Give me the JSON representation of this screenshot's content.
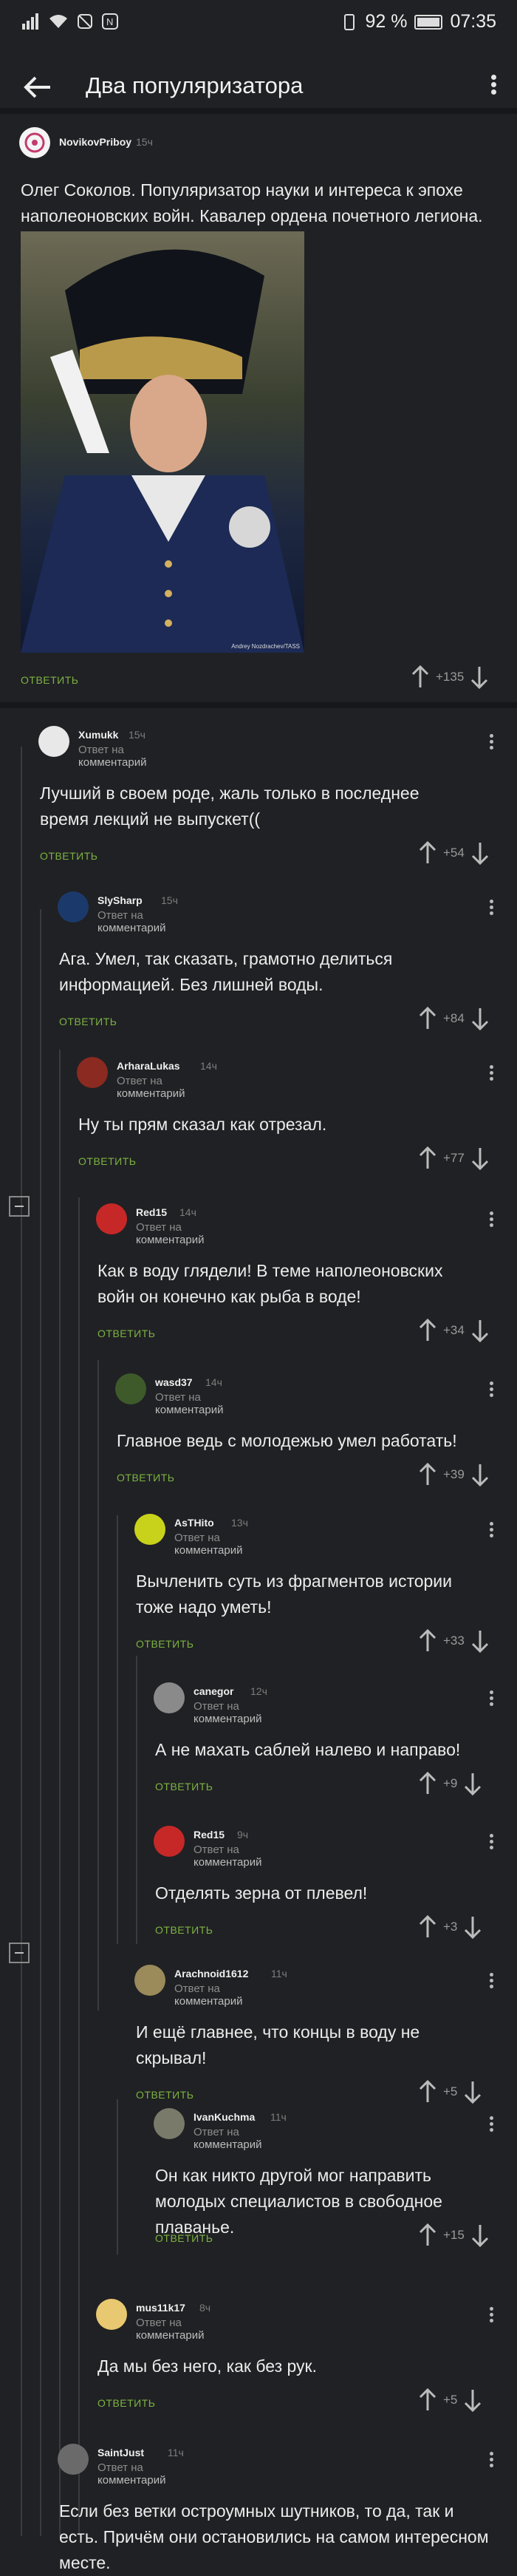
{
  "status_bar": {
    "battery": "92 %",
    "time": "07:35"
  },
  "app_bar": {
    "title": "Два популяризатора"
  },
  "reply_prefix": "Ответ на",
  "reply_word": "комментарий",
  "reply_label": "ОТВЕТИТЬ",
  "post": {
    "author": "NovikovPriboy",
    "time": "15ч",
    "text": "Олег Соколов. Популяризатор науки и интереса к эпохе наполеоновских войн. Кавалер ордена почетного легиона.",
    "photo_caption": "Andrey Nozdrachev/TASS",
    "score": "+135"
  },
  "comments": [
    {
      "author": "Xumukk",
      "time": "15ч",
      "text": "Лучший в своем роде, жаль только в последнее время лекций не выпускет((",
      "score": "+54"
    },
    {
      "author": "SlySharp",
      "time": "15ч",
      "text": "Ага. Умел, так сказать, грамотно делиться информацией. Без лишней воды.",
      "score": "+84"
    },
    {
      "author": "ArharaLukas",
      "time": "14ч",
      "text": "Ну ты прям сказал как отрезал.",
      "score": "+77"
    },
    {
      "author": "Red15",
      "time": "14ч",
      "text": "Как в воду глядели! В теме наполеоновских войн он конечно как рыба в воде!",
      "score": "+34"
    },
    {
      "author": "wasd37",
      "time": "14ч",
      "text": "Главное ведь с молодежью умел работать!",
      "score": "+39"
    },
    {
      "author": "AsTHito",
      "time": "13ч",
      "text": "Вычленить суть из фрагментов истории тоже надо уметь!",
      "score": "+33"
    },
    {
      "author": "canegor",
      "time": "12ч",
      "text": "А не махать саблей налево и направо!",
      "score": "+9"
    },
    {
      "author": "Red15",
      "time": "9ч",
      "text": "Отделять зерна от плевел!",
      "score": "+3"
    },
    {
      "author": "Arachnoid1612",
      "time": "11ч",
      "text": "И ещё главнее, что концы в воду не скрывал!",
      "score": "+5"
    },
    {
      "author": "IvanKuchma",
      "time": "11ч",
      "text": "Он как никто другой мог направить молодых специалистов в свободное плаванье.",
      "score": "+15"
    },
    {
      "author": "mus11k17",
      "time": "8ч",
      "text": "Да мы без него, как без рук.",
      "score": "+5"
    },
    {
      "author": "SaintJust",
      "time": "11ч",
      "text": "Если без ветки остроумных шутников, то да, так и есть. Причём они остановились на самом интересном месте.",
      "score": ""
    }
  ],
  "colors": {
    "background": "#202124",
    "accent": "#7cb342",
    "text": "#ececec"
  }
}
